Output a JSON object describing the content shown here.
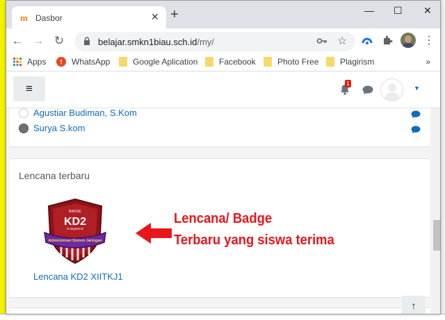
{
  "browser": {
    "tab_title": "Dasbor",
    "tab_favicon_text": "m",
    "new_tab": "+",
    "close_tab": "✕",
    "url_host": "belajar.smkn1biau.sch.id",
    "url_path": "/my/",
    "window_controls": [
      "—",
      "☐",
      "✕"
    ]
  },
  "bookmarks": {
    "items": [
      "Apps",
      "WhatsApp",
      "Google Aplication",
      "Facebook",
      "Photo Free",
      "Plagirism"
    ],
    "more": "»"
  },
  "navbar": {
    "menu_icon": "≡",
    "notification_count": "1",
    "user_menu_caret": "▼"
  },
  "contacts": {
    "items": [
      {
        "name": "Agustiar Budiman, S.Kom"
      },
      {
        "name": "Surya S.kom"
      }
    ]
  },
  "badges_block": {
    "title": "Lencana terbaru",
    "badge_label": "Lencana KD2 XIITKJ1",
    "badge_art_text": "KD2",
    "badge_art_small_top": "BADGE",
    "badge_art_small_sub": "Kompetensi",
    "badge_art_ribbon": "Administrasi Sistem Jaringan"
  },
  "annotation": {
    "line1": "Lencana/ Badge",
    "line2": "Terbaru yang siswa terima",
    "color": "#e8161b"
  },
  "back_to_top": "↑",
  "colors": {
    "link": "#0f6cbf",
    "accent_orange": "#f98012",
    "badge_purple": "#6b2aa0",
    "badge_red": "#8e1318"
  }
}
